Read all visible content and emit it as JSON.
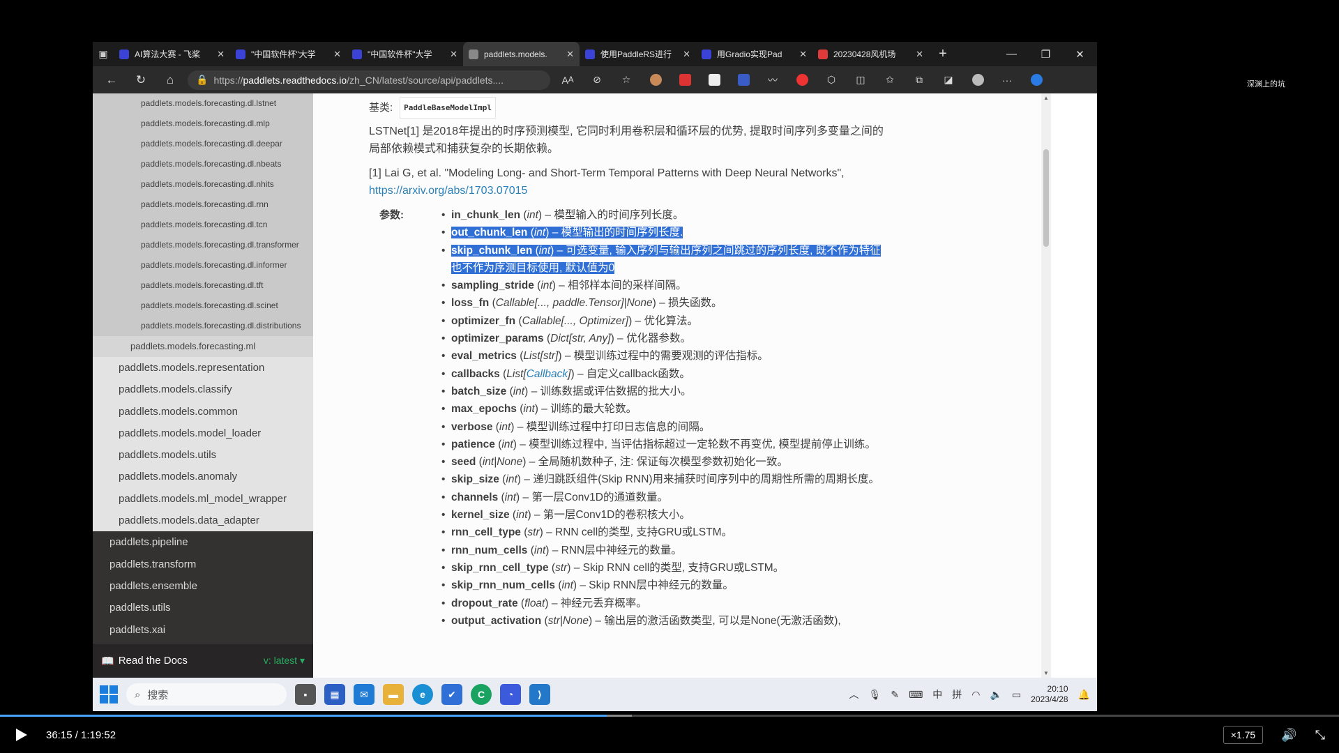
{
  "browser": {
    "tabs": [
      {
        "title": "AI算法大赛 - 飞桨",
        "color": "#3b43d6"
      },
      {
        "title": "\"中国软件杯\"大学",
        "color": "#3b43d6"
      },
      {
        "title": "\"中国软件杯\"大学",
        "color": "#3b43d6"
      },
      {
        "title": "paddlets.models.",
        "color": "#888888",
        "active": true
      },
      {
        "title": "使用PaddleRS进行",
        "color": "#3b43d6"
      },
      {
        "title": "用Gradio实现Pad",
        "color": "#3b43d6"
      },
      {
        "title": "20230428风机场",
        "color": "#e03a3a"
      }
    ],
    "url_prefix": "https://",
    "url_host": "paddlets.readthedocs.io",
    "url_path": "/zh_CN/latest/source/api/paddlets....",
    "corner_label": "深渊上的坑"
  },
  "sidebar": {
    "level4": [
      "paddlets.models.forecasting.dl.lstnet",
      "paddlets.models.forecasting.dl.mlp",
      "paddlets.models.forecasting.dl.deepar",
      "paddlets.models.forecasting.dl.nbeats",
      "paddlets.models.forecasting.dl.nhits",
      "paddlets.models.forecasting.dl.rnn",
      "paddlets.models.forecasting.dl.tcn",
      "paddlets.models.forecasting.dl.transformer",
      "paddlets.models.forecasting.dl.informer",
      "paddlets.models.forecasting.dl.tft",
      "paddlets.models.forecasting.dl.scinet",
      "paddlets.models.forecasting.dl.distributions"
    ],
    "level3": [
      "paddlets.models.forecasting.ml"
    ],
    "level2": [
      "paddlets.models.representation",
      "paddlets.models.classify",
      "paddlets.models.common",
      "paddlets.models.model_loader",
      "paddlets.models.utils",
      "paddlets.models.anomaly",
      "paddlets.models.ml_model_wrapper",
      "paddlets.models.data_adapter"
    ],
    "level1": [
      "paddlets.pipeline",
      "paddlets.transform",
      "paddlets.ensemble",
      "paddlets.utils",
      "paddlets.xai"
    ],
    "rtd_label": "Read the Docs",
    "version": "v: latest"
  },
  "doc": {
    "base_label": "基类:",
    "base_class": "PaddleBaseModelImpl",
    "intro": "LSTNet[1] 是2018年提出的时序预测模型, 它同时利用卷积层和循环层的优势, 提取时间序列多变量之间的局部依赖模式和捕获复杂的长期依赖。",
    "ref": "[1] Lai G, et al. \"Modeling Long- and Short-Term Temporal Patterns with Deep Neural Networks\",",
    "ref_link": "https://arxiv.org/abs/1703.07015",
    "params_label": "参数:",
    "params": [
      {
        "name": "in_chunk_len",
        "type": "int",
        "desc": "模型输入的时间序列长度。"
      },
      {
        "name": "out_chunk_len",
        "type": "int",
        "desc": "模型输出的时间序列长度.",
        "hl": true
      },
      {
        "name": "skip_chunk_len",
        "type": "int",
        "desc": "可选变量, 输入序列与输出序列之间跳过的序列长度, 既不作为特征也不作为序测目标使用, 默认值为0",
        "hl": true
      },
      {
        "name": "sampling_stride",
        "type": "int",
        "desc": "相邻样本间的采样间隔。"
      },
      {
        "name": "loss_fn",
        "type": "Callable[..., paddle.Tensor]|None",
        "desc": "损失函数。"
      },
      {
        "name": "optimizer_fn",
        "type": "Callable[..., Optimizer]",
        "desc": "优化算法。"
      },
      {
        "name": "optimizer_params",
        "type": "Dict[str, Any]",
        "desc": "优化器参数。"
      },
      {
        "name": "eval_metrics",
        "type": "List[str]",
        "desc": "模型训练过程中的需要观测的评估指标。"
      },
      {
        "name": "callbacks",
        "type_pre": "List[",
        "type_link": "Callback",
        "type_post": "]",
        "desc": "自定义callback函数。"
      },
      {
        "name": "batch_size",
        "type": "int",
        "desc": "训练数据或评估数据的批大小。"
      },
      {
        "name": "max_epochs",
        "type": "int",
        "desc": "训练的最大轮数。"
      },
      {
        "name": "verbose",
        "type": "int",
        "desc": "模型训练过程中打印日志信息的间隔。"
      },
      {
        "name": "patience",
        "type": "int",
        "desc": "模型训练过程中, 当评估指标超过一定轮数不再变优, 模型提前停止训练。"
      },
      {
        "name": "seed",
        "type": "int|None",
        "desc": "全局随机数种子, 注: 保证每次模型参数初始化一致。"
      },
      {
        "name": "skip_size",
        "type": "int",
        "desc": "递归跳跃组件(Skip RNN)用来捕获时间序列中的周期性所需的周期长度。"
      },
      {
        "name": "channels",
        "type": "int",
        "desc": "第一层Conv1D的通道数量。"
      },
      {
        "name": "kernel_size",
        "type": "int",
        "desc": "第一层Conv1D的卷积核大小。"
      },
      {
        "name": "rnn_cell_type",
        "type": "str",
        "desc": "RNN cell的类型, 支持GRU或LSTM。"
      },
      {
        "name": "rnn_num_cells",
        "type": "int",
        "desc": "RNN层中神经元的数量。"
      },
      {
        "name": "skip_rnn_cell_type",
        "type": "str",
        "desc": "Skip RNN cell的类型, 支持GRU或LSTM。"
      },
      {
        "name": "skip_rnn_num_cells",
        "type": "int",
        "desc": "Skip RNN层中神经元的数量。"
      },
      {
        "name": "dropout_rate",
        "type": "float",
        "desc": "神经元丢弃概率。"
      },
      {
        "name": "output_activation",
        "type": "str|None",
        "desc": "输出层的激活函数类型, 可以是None(无激活函数),"
      }
    ]
  },
  "taskbar": {
    "search_placeholder": "搜索",
    "ime1": "中",
    "ime2": "拼",
    "time": "20:10",
    "date": "2023/4/28"
  },
  "player": {
    "time": "36:15 / 1:19:52",
    "speed": "×1.75",
    "progress_fraction": 0.453
  }
}
